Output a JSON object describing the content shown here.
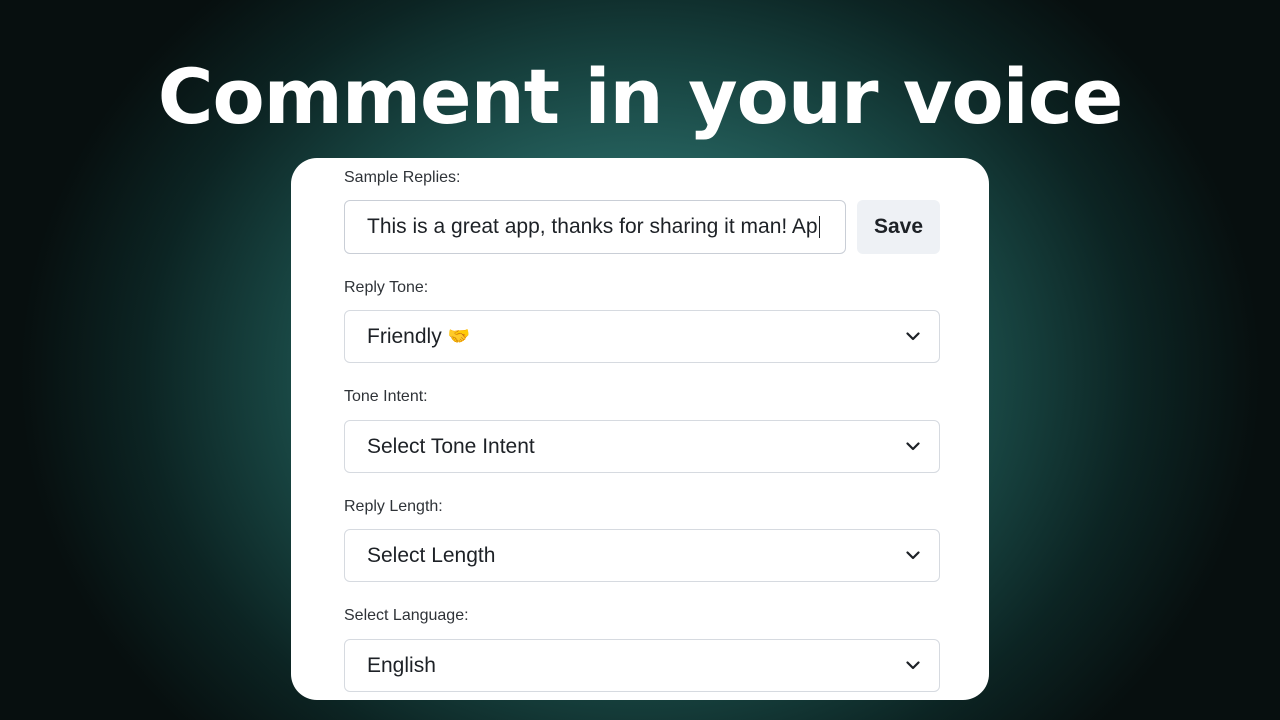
{
  "headline": "Comment in your voice",
  "sample_replies": {
    "label": "Sample Replies:",
    "value": "This is a great app, thanks for sharing it man! Ap",
    "save_label": "Save"
  },
  "reply_tone": {
    "label": "Reply Tone:",
    "value": "Friendly",
    "emoji": "🤝"
  },
  "tone_intent": {
    "label": "Tone Intent:",
    "value": "Select Tone Intent"
  },
  "reply_length": {
    "label": "Reply Length:",
    "value": "Select Length"
  },
  "language": {
    "label": "Select Language:",
    "value": "English"
  },
  "colors": {
    "background_glow": "#3f8f8a",
    "card": "#ffffff",
    "save_button": "#eef1f5",
    "text": "#1d2126"
  },
  "icons": {
    "dropdown": "chevron-down-icon"
  }
}
